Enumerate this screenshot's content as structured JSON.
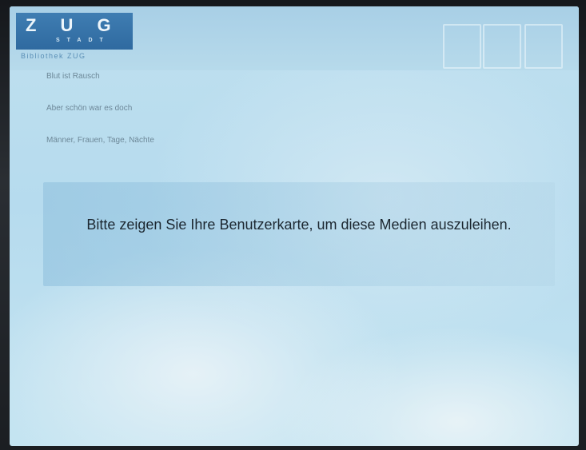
{
  "header": {
    "logo_main": "Z U G",
    "logo_sub": "STADT",
    "title": "Bibliothek ZUG",
    "small_text": ""
  },
  "items": [
    {
      "title": "Blut ist Rausch",
      "subtitle": ""
    },
    {
      "title": "Aber schön war es doch",
      "subtitle": ""
    },
    {
      "title": "Männer, Frauen, Tage, Nächte",
      "subtitle": ""
    }
  ],
  "message": "Bitte zeigen Sie Ihre Benutzerkarte, um diese Medien auszuleihen.",
  "footer": {
    "text": ""
  }
}
